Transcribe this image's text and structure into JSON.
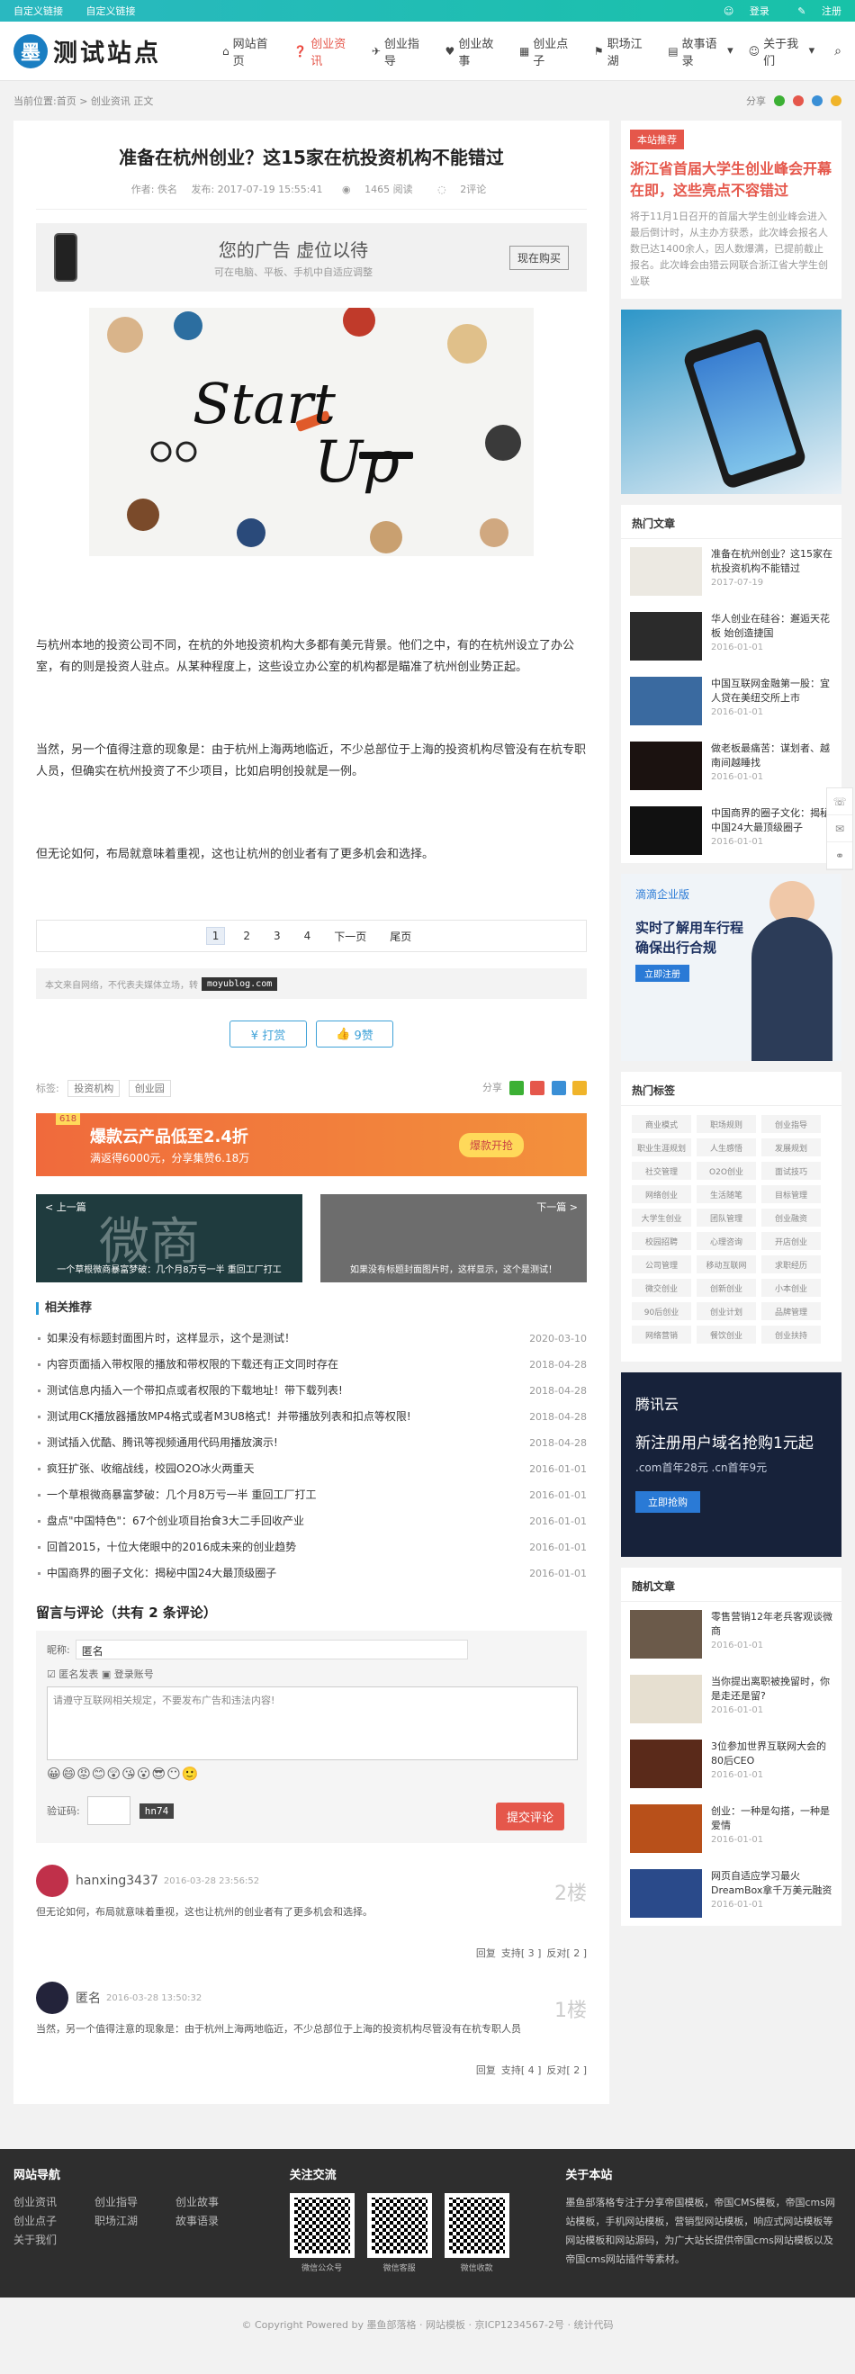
{
  "topbar": {
    "links": [
      "自定义链接",
      "自定义链接"
    ],
    "login": "登录",
    "register": "注册"
  },
  "header": {
    "logo_char": "墨",
    "logo_text": "测试站点",
    "nav": [
      {
        "icon": "home-icon",
        "glyph": "⌂",
        "label": "网站首页",
        "active": false
      },
      {
        "icon": "question-icon",
        "glyph": "❓",
        "label": "创业资讯",
        "active": true
      },
      {
        "icon": "plane-icon",
        "glyph": "✈",
        "label": "创业指导",
        "active": false
      },
      {
        "icon": "heart-icon",
        "glyph": "♥",
        "label": "创业故事",
        "active": false
      },
      {
        "icon": "grid-icon",
        "glyph": "▦",
        "label": "创业点子",
        "active": false
      },
      {
        "icon": "flag-icon",
        "glyph": "⚑",
        "label": "职场江湖",
        "active": false
      },
      {
        "icon": "book-icon",
        "glyph": "▤",
        "label": "故事语录",
        "active": false
      },
      {
        "icon": "user-icon",
        "glyph": "☺",
        "label": "关于我们",
        "active": false
      }
    ]
  },
  "breadcrumb": {
    "text": "当前位置:首页 > 创业资讯 正文",
    "share": "分享"
  },
  "article": {
    "title": "准备在杭州创业？这15家在杭投资机构不能错过",
    "author": "作者: 佚名",
    "date": "发布: 2017-07-19 15:55:41",
    "views": "1465 阅读",
    "comments": "2评论",
    "ad": {
      "title": "您的广告 虚位以待",
      "sub": "可在电脑、平板、手机中自适应调整",
      "button": "现在购买"
    },
    "hero": {
      "word1": "Start",
      "word2": "Up"
    },
    "paragraphs": [
      "与杭州本地的投资公司不同，在杭的外地投资机构大多都有美元背景。他们之中，有的在杭州设立了办公室，有的则是投资人驻点。从某种程度上，这些设立办公室的机构都是瞄准了杭州创业势正起。",
      "当然，另一个值得注意的现象是：由于杭州上海两地临近，不少总部位于上海的投资机构尽管没有在杭专职人员，但确实在杭州投资了不少项目，比如启明创投就是一例。",
      "但无论如何，布局就意味着重视，这也让杭州的创业者有了更多机会和选择。"
    ],
    "pager": {
      "pages": [
        "1",
        "2",
        "3",
        "4"
      ],
      "next": "下一页",
      "last": "尾页"
    },
    "source": {
      "text": "本文来自网络，不代表夫媒体立场，转",
      "url": "moyublog.com"
    },
    "reward": "¥ 打赏",
    "like": "9赞",
    "tags_label": "标签:",
    "tags": [
      "投资机构",
      "创业园"
    ],
    "share_label": "分享"
  },
  "banner2": {
    "badge": "618",
    "main": "爆款云产品低至2.4折",
    "sub": "满返得6000元，分享集赞6.18万",
    "button": "爆款开抢"
  },
  "prevnext": {
    "prev_label": "< 上一篇",
    "prev_title": "一个草根微商暴富梦破：几个月8万亏一半 重回工厂打工",
    "prev_big": "微商",
    "next_label": "下一篇 >",
    "next_title": "如果没有标题封面图片时，这样显示，这个是测试！"
  },
  "related": {
    "heading": "相关推荐",
    "items": [
      {
        "title": "如果没有标题封面图片时，这样显示，这个是测试！",
        "date": "2020-03-10"
      },
      {
        "title": "内容页面插入带权限的播放和带权限的下载还有正文同时存在",
        "date": "2018-04-28"
      },
      {
        "title": "测试信息内插入一个带扣点或者权限的下载地址！带下载列表!",
        "date": "2018-04-28"
      },
      {
        "title": "测试用CK播放器播放MP4格式或者M3U8格式！并带播放列表和扣点等权限!",
        "date": "2018-04-28"
      },
      {
        "title": "测试插入优酷、腾讯等视频通用代码用播放演示!",
        "date": "2018-04-28"
      },
      {
        "title": "疯狂扩张、收缩战线，校园O2O冰火两重天",
        "date": "2016-01-01"
      },
      {
        "title": "一个草根微商暴富梦破：几个月8万亏一半 重回工厂打工",
        "date": "2016-01-01"
      },
      {
        "title": "盘点\"中国特色\"：67个创业项目抬食3大二手回收产业",
        "date": "2016-01-01"
      },
      {
        "title": "回首2015，十位大佬眼中的2016成未来的创业趋势",
        "date": "2016-01-01"
      },
      {
        "title": "中国商界的圈子文化：揭秘中国24大最顶级圈子",
        "date": "2016-01-01"
      }
    ]
  },
  "comment_form": {
    "title": "留言与评论（共有 2 条评论）",
    "name_label": "昵称:",
    "name_value": "匿名",
    "anon": "☑ 匿名发表",
    "login": "▣ 登录账号",
    "placeholder": "请遵守互联网相关规定，不要发布广告和违法内容!",
    "emojis": "😀😄😡😊😲😘😮😎😶🙂",
    "captcha_label": "验证码:",
    "captcha_img": "hn74",
    "submit": "提交评论"
  },
  "comments": [
    {
      "name": "hanxing3437",
      "date": "2016-03-28 23:56:52",
      "floor": "2楼",
      "body": "但无论如何，布局就意味着重视，这也让杭州的创业者有了更多机会和选择。",
      "reply": "回复",
      "support": "支持[ 3 ]",
      "oppose": "反对[ 2 ]"
    },
    {
      "name": "匿名",
      "date": "2016-03-28 13:50:32",
      "floor": "1楼",
      "body": "当然，另一个值得注意的现象是：由于杭州上海两地临近，不少总部位于上海的投资机构尽管没有在杭专职人员",
      "reply": "回复",
      "support": "支持[ 4 ]",
      "oppose": "反对[ 2 ]"
    }
  ],
  "sidebar": {
    "rec_label": "本站推荐",
    "rec_title": "浙江省首届大学生创业峰会开幕在即，这些亮点不容错过",
    "rec_desc": "将于11月1日召开的首届大学生创业峰会进入最后倒计时，从主办方获悉，此次峰会报名人数已达1400余人，因人数爆满，已提前截止报名。此次峰会由猎云网联合浙江省大学生创业联",
    "hot_heading": "热门文章",
    "hot": [
      {
        "title": "准备在杭州创业？这15家在杭投资机构不能错过",
        "date": "2017-07-19",
        "color": "#ece9e2"
      },
      {
        "title": "华人创业在硅谷：邂逅天花板 始创造捷国",
        "date": "2016-01-01",
        "color": "#2b2b2b"
      },
      {
        "title": "中国互联网金融第一股：宜人贷在美纽交所上市",
        "date": "2016-01-01",
        "color": "#3a6aa0"
      },
      {
        "title": "做老板最痛苦：谋划者、越南间越睡找",
        "date": "2016-01-01",
        "color": "#1b1210"
      },
      {
        "title": "中国商界的圈子文化：揭秘中国24大最顶级圈子",
        "date": "2016-01-01",
        "color": "#111111"
      }
    ],
    "ad2": {
      "logo": "滴滴企业版",
      "main": "实时了解用车行程 确保出行合规",
      "button": "立即注册"
    },
    "tags_heading": "热门标签",
    "tags": [
      "商业模式",
      "职场规则",
      "创业指导",
      "职业生涯规划",
      "人生感悟",
      "发展规划",
      "社交管理",
      "O2O创业",
      "面试技巧",
      "网络创业",
      "生活随笔",
      "目标管理",
      "大学生创业",
      "团队管理",
      "创业融资",
      "校园招聘",
      "心理咨询",
      "开店创业",
      "公司管理",
      "移动互联网",
      "求职经历",
      "微交创业",
      "创新创业",
      "小本创业",
      "90后创业",
      "创业计划",
      "品牌管理",
      "网络营销",
      "餐饮创业",
      "创业扶持"
    ],
    "ad3": {
      "logo": "腾讯云",
      "main": "新注册用户域名抢购1元起",
      ".com": ".com首年28元 .cn首年9元",
      "button": "立即抢购"
    },
    "random_heading": "随机文章",
    "random": [
      {
        "title": "零售营销12年老兵客观谈微商",
        "date": "2016-01-01",
        "color": "#6b5a4a"
      },
      {
        "title": "当你提出离职被挽留时，你是走还是留?",
        "date": "2016-01-01",
        "color": "#e6dfd0"
      },
      {
        "title": "3位参加世界互联网大会的80后CEO",
        "date": "2016-01-01",
        "color": "#5a2a1a"
      },
      {
        "title": "创业：一种是勾搭，一种是爱情",
        "date": "2016-01-01",
        "color": "#b8501a"
      },
      {
        "title": "网页自适应学习最火DreamBox拿千万美元融资",
        "date": "2016-01-01",
        "color": "#2a4a8a"
      }
    ]
  },
  "footer": {
    "nav_heading": "网站导航",
    "nav": [
      "创业资讯",
      "创业指导",
      "创业故事",
      "创业点子",
      "职场江湖",
      "故事语录",
      "关于我们"
    ],
    "follow_heading": "关注交流",
    "qrs": [
      "微信公众号",
      "微信客服",
      "微信收款"
    ],
    "about_heading": "关于本站",
    "about": "墨鱼部落格专注于分享帝国模板，帝国CMS模板，帝国cms网站模板，手机网站模板，营销型网站模板，响应式网站模板等网站模板和网站源码，为广大站长提供帝国cms网站模板以及帝国cms网站插件等素材。",
    "copyright": "© Copyright Powered by 墨鱼部落格 · 网站模板 · 京ICP1234567-2号 · 统计代码"
  }
}
